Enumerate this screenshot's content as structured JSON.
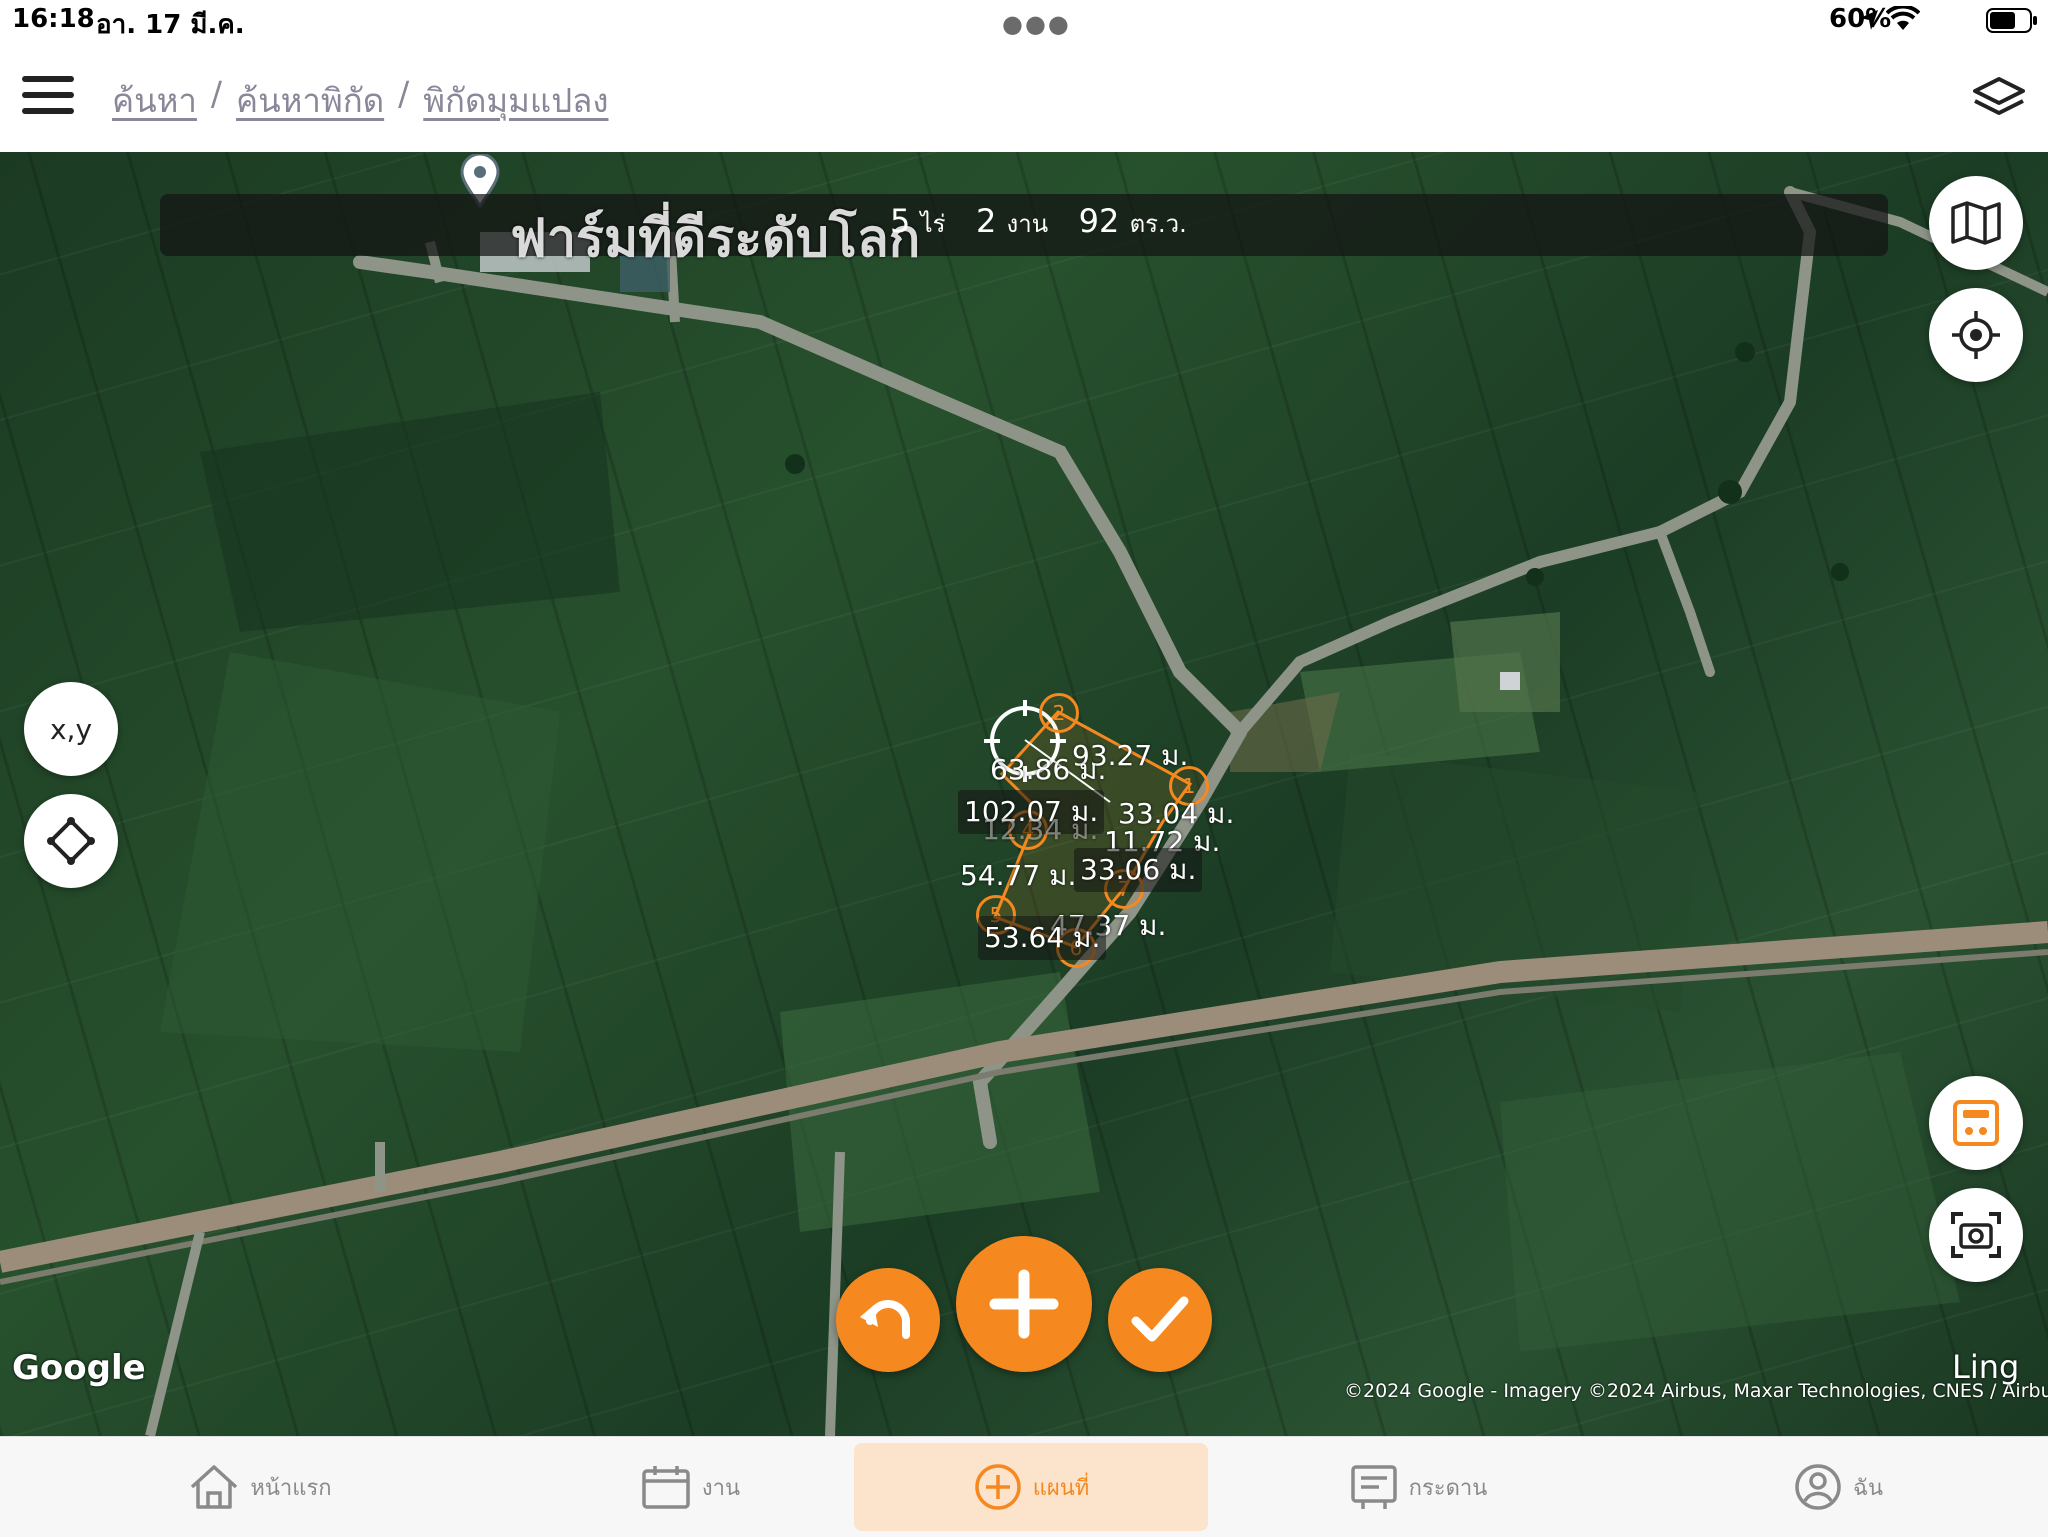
{
  "status_bar": {
    "time": "16:18",
    "date": "อา. 17 มี.ค.",
    "battery": "60%"
  },
  "header": {
    "breadcrumb": [
      "ค้นหา",
      "ค้นหาพิกัด",
      "พิกัดมุมแปลง"
    ]
  },
  "map": {
    "farm_sign": "ฟาร์มที่ดีระดับโลก",
    "area": {
      "rai_value": "5",
      "rai_unit": "ไร่",
      "ngan_value": "2",
      "ngan_unit": "งาน",
      "wa_value": "92",
      "wa_unit": "ตร.ว."
    },
    "xy_label": "x,y",
    "measurements": [
      "93.27 ม.",
      "63.86 ม.",
      "102.07 ม.",
      "33.04 ม.",
      "12.34 ม.",
      "11.72 ม.",
      "54.77 ม.",
      "33.06 ม.",
      "47.37 ม.",
      "53.64 ม."
    ],
    "vertices": [
      "1",
      "2",
      "4",
      "5",
      "6",
      "7"
    ],
    "google_logo": "Google",
    "copyright": "©2024 Google - Imagery ©2024 Airbus, Maxar Technologies, CNES / Airbus",
    "ling": "Ling"
  },
  "colors": {
    "accent": "#f5891f",
    "header_bg": "#ffffff",
    "breadcrumb_text": "#8a8799"
  },
  "bottom_nav": {
    "items": [
      {
        "label": "หน้าแรก",
        "icon": "home-icon"
      },
      {
        "label": "งาน",
        "icon": "calendar-icon"
      },
      {
        "label": "แผนที่",
        "icon": "plus-circle-icon",
        "active": true
      },
      {
        "label": "กระดาน",
        "icon": "board-icon"
      },
      {
        "label": "ฉัน",
        "icon": "user-icon"
      }
    ]
  }
}
